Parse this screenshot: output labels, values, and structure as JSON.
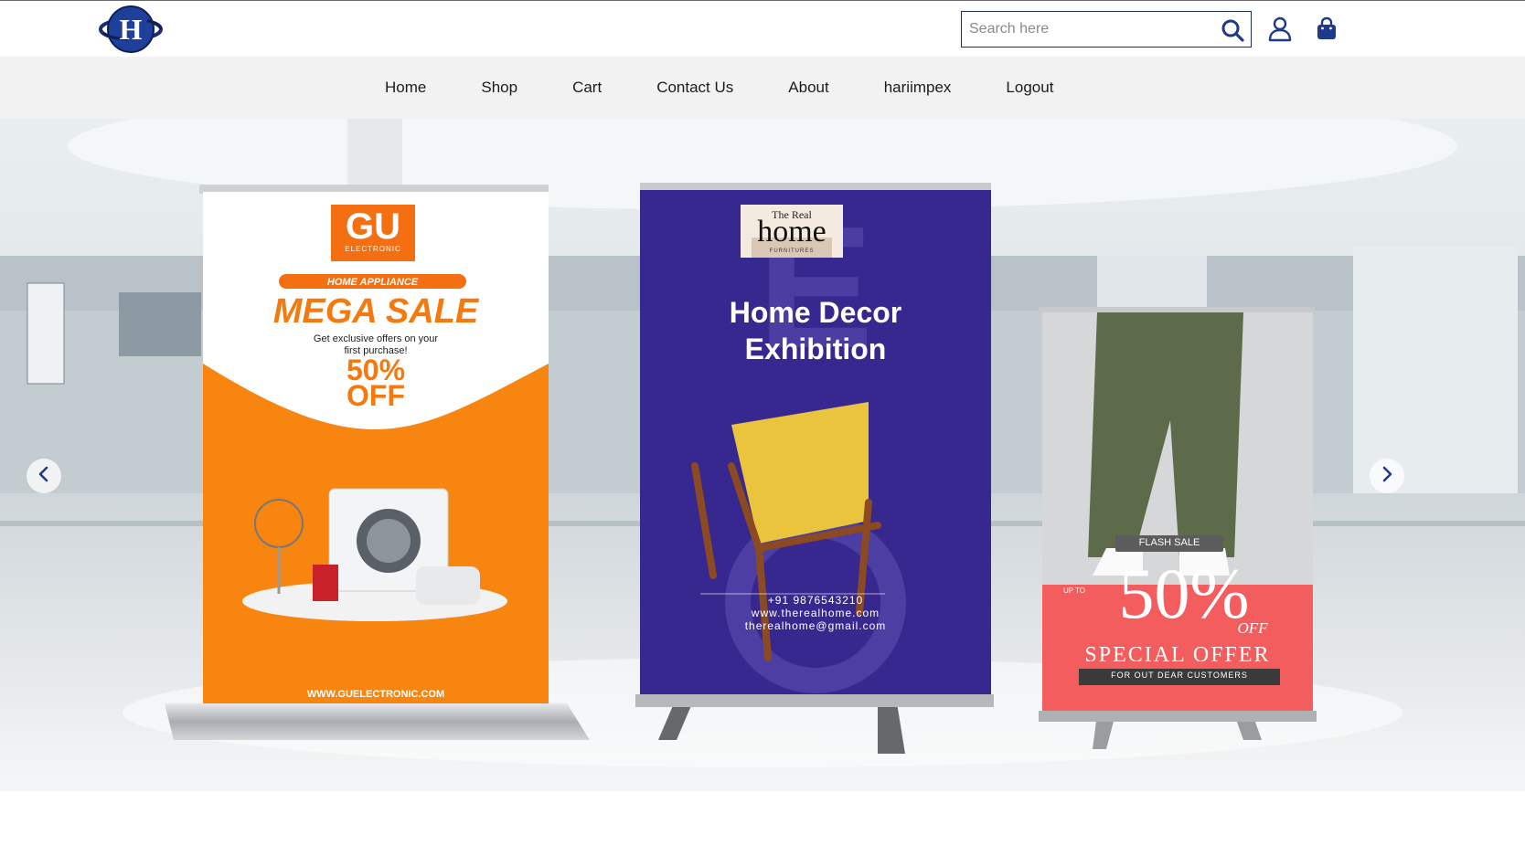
{
  "header": {
    "search_placeholder": "Search here"
  },
  "icons": {
    "logo": "company-logo",
    "search": "search-icon",
    "user": "user-icon",
    "cart": "shopping-bag-icon",
    "prev": "chevron-left-icon",
    "next": "chevron-right-icon"
  },
  "nav": {
    "items": [
      "Home",
      "Shop",
      "Cart",
      "Contact Us",
      "About",
      "hariimpex",
      "Logout"
    ]
  },
  "colors": {
    "brand_navy": "#1f3a8a",
    "orange": "#f7850f",
    "purple": "#37288f",
    "coral": "#f35d5d"
  },
  "hero": {
    "banner1": {
      "brand": "GU",
      "brand_sub": "ELECTRONIC",
      "tag": "HOME APPLIANCE",
      "headline": "MEGA SALE",
      "line1": "Get exclusive offers on your",
      "line2": "first purchase!",
      "discount": "50%",
      "discount_word": "OFF",
      "website": "WWW.GUELECTRONIC.COM"
    },
    "banner2": {
      "logo_top": "The Real",
      "logo_main": "home",
      "logo_sub": "FURNITURES",
      "title1": "Home Decor",
      "title2": "Exhibition",
      "phone": "+91 9876543210",
      "web": "www.therealhome.com",
      "email": "therealhome@gmail.com"
    },
    "banner3": {
      "tag": "FLASH SALE",
      "upto": "UP TO",
      "discount": "50%",
      "off": "OFF",
      "offer": "SPECIAL OFFER",
      "sub": "FOR OUT DEAR CUSTOMERS"
    }
  }
}
